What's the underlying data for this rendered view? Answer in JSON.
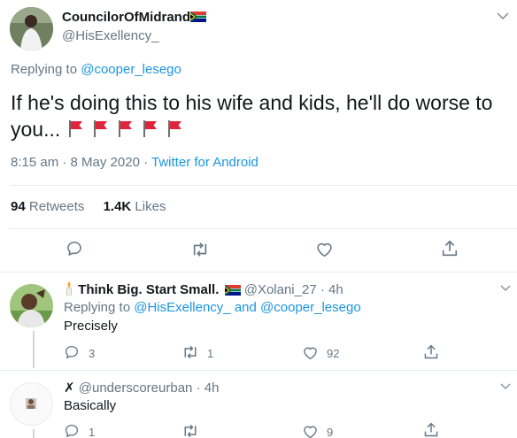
{
  "main_tweet": {
    "display_name": "CouncilorOfMidrand",
    "handle": "@HisExellency_",
    "flag_icon": "south-africa-flag-icon",
    "replying_prefix": "Replying to",
    "replying_to": "@cooper_lesego",
    "text_line1": "If he's doing this to his wife and kids, he'll do worse to",
    "text_line2": "you...",
    "emoji": [
      "red-flag-icon",
      "red-flag-icon",
      "red-flag-icon",
      "red-flag-icon",
      "red-flag-icon"
    ],
    "time": "8:15 am",
    "sep": "·",
    "date": "8 May 2020",
    "source": "Twitter for Android",
    "retweets_count": "94",
    "retweets_label": "Retweets",
    "likes_count": "1.4K",
    "likes_label": "Likes"
  },
  "replies": [
    {
      "display_name": "Think Big. Start Small.",
      "prefix_icon": "candle-icon",
      "flag_icon": "south-africa-flag-icon",
      "handle": "@Xolani_27",
      "sep": "·",
      "time": "4h",
      "replying_prefix": "Replying to",
      "replying_to_1": "@HisExellency_",
      "and": "and",
      "replying_to_2": "@cooper_lesego",
      "text": "Precisely",
      "reply_count": "3",
      "retweet_count": "1",
      "like_count": "92"
    },
    {
      "display_name": "✗",
      "handle": "@underscoreurban",
      "sep": "·",
      "time": "4h",
      "text": "Basically",
      "reply_count": "1",
      "retweet_count": "",
      "like_count": "9"
    }
  ],
  "colors": {
    "link": "#1b95e0",
    "muted": "#657786",
    "text": "#14171a",
    "divider": "#e6ecf0",
    "flag_red": "#e0243c"
  }
}
